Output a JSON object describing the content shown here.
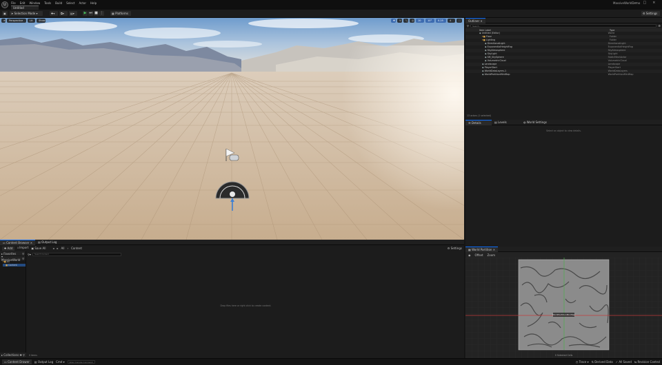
{
  "app": {
    "name": "Unreal Editor",
    "project_tab": "Untitled",
    "title_right": "MassiveWorldDemo"
  },
  "menu": [
    "File",
    "Edit",
    "Window",
    "Tools",
    "Build",
    "Select",
    "Actor",
    "Help"
  ],
  "toolbar": {
    "save": "",
    "mode": "Selection Mode",
    "platforms": "Platforms",
    "settings": "Settings"
  },
  "viewport": {
    "perspective": "Perspective",
    "lit": "Lit",
    "show": "Show",
    "numbers": [
      "10",
      "10°",
      "0.25",
      "4"
    ]
  },
  "outliner": {
    "tab": "Outliner",
    "search_placeholder": "Search...",
    "col_label": "Item Label",
    "col_type": "Type",
    "items": [
      {
        "label": "Untitled (Editor)",
        "type": "World",
        "indent": 0
      },
      {
        "label": "Floor",
        "type": "Folder",
        "indent": 1
      },
      {
        "label": "Lighting",
        "type": "Folder",
        "indent": 1
      },
      {
        "label": "DirectionalLight",
        "type": "DirectionalLight",
        "indent": 2
      },
      {
        "label": "ExponentialHeightFog",
        "type": "ExponentialHeightFog",
        "indent": 2
      },
      {
        "label": "SkyAtmosphere",
        "type": "SkyAtmosphere",
        "indent": 2
      },
      {
        "label": "SkyLight",
        "type": "SkyLight",
        "indent": 2
      },
      {
        "label": "SM_SkySphere",
        "type": "StaticMeshActor",
        "indent": 2
      },
      {
        "label": "VolumetricCloud",
        "type": "VolumetricCloud",
        "indent": 2
      },
      {
        "label": "Landscape",
        "type": "Landscape",
        "indent": 1
      },
      {
        "label": "PlayerStart",
        "type": "PlayerStart",
        "indent": 1
      },
      {
        "label": "WorldDataLayers-1",
        "type": "WorldDataLayers",
        "indent": 1
      },
      {
        "label": "WorldPartitionMiniMap",
        "type": "WorldPartitionMiniMap",
        "indent": 1
      }
    ],
    "footer": "13 actors (1 selected)"
  },
  "details": {
    "tabs": [
      "Details",
      "Levels",
      "World Settings"
    ],
    "empty": "Select an object to view details."
  },
  "content_browser": {
    "tabs": [
      "Content Browser",
      "Output Log"
    ],
    "add": "Add",
    "import": "Import",
    "save_all": "Save All",
    "path": [
      "All",
      "Content"
    ],
    "settings": "Settings",
    "favorites": "Favorites",
    "project": "MassiveWorld",
    "tree": [
      "All",
      "Content"
    ],
    "search_placeholder": "Search Content",
    "empty": "Drop files here or right click to create content.",
    "count": "0 items",
    "collections": "Collections"
  },
  "world_partition": {
    "tab": "World Partition",
    "buttons": [
      "Offset",
      "Zoom"
    ],
    "minimap_label": "WorldPartitionMiniMap",
    "footer": "0 Selected Cells"
  },
  "statusbar": {
    "drawer": "Content Drawer",
    "output": "Output Log",
    "cmd": "Cmd",
    "console_placeholder": "Enter Console Command",
    "trace": "Trace",
    "derived": "Derived Data",
    "unsaved": "All Saved",
    "revision": "Revision Control"
  },
  "colors": {
    "accent": "#0d6efd",
    "select": "#234a80"
  }
}
